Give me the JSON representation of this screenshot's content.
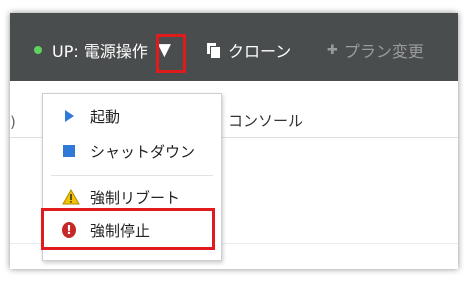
{
  "toolbar": {
    "power_label": "UP: 電源操作",
    "caret": "▼",
    "clone_label": "クローン",
    "plan_change_label": "プラン変更"
  },
  "tabs": {
    "left_fragment": ")",
    "console_label": "コンソール"
  },
  "power_menu": {
    "items": [
      {
        "label": "起動",
        "icon": "play-icon"
      },
      {
        "label": "シャットダウン",
        "icon": "stop-square-icon"
      },
      {
        "label": "強制リブート",
        "icon": "warning-icon"
      },
      {
        "label": "強制停止",
        "icon": "error-icon"
      }
    ]
  },
  "colors": {
    "toolbar_bg": "#4a4d4e",
    "status_green": "#5fd25f",
    "highlight_red": "#e01b1b",
    "accent_blue": "#2f7ad6",
    "danger_red": "#c62828",
    "warning_yellow": "#f5c400"
  }
}
